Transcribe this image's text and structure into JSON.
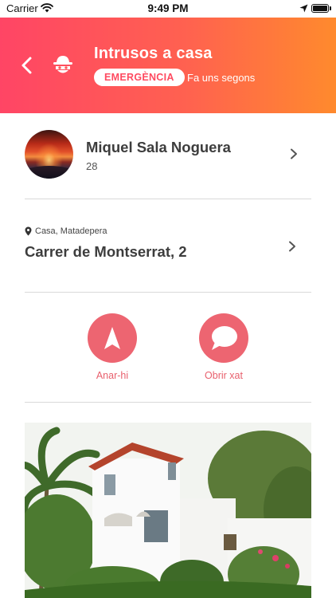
{
  "status_bar": {
    "carrier": "Carrier",
    "time": "9:49 PM"
  },
  "header": {
    "title": "Intrusos a casa",
    "badge": "EMERGÈNCIA",
    "time_ago": "Fa uns segons",
    "icon": "burglar-icon",
    "gradient": [
      "#ff4565",
      "#ff8a2d"
    ]
  },
  "person": {
    "name": "Miquel Sala Noguera",
    "age": "28"
  },
  "location": {
    "label": "Casa, Matadepera",
    "address": "Carrer de Montserrat, 2"
  },
  "actions": [
    {
      "label": "Anar-hi",
      "icon": "navigation-arrow-icon"
    },
    {
      "label": "Obrir xat",
      "icon": "chat-bubble-icon"
    }
  ],
  "colors": {
    "accent": "#ed6571",
    "accent_text": "#e8606d"
  }
}
